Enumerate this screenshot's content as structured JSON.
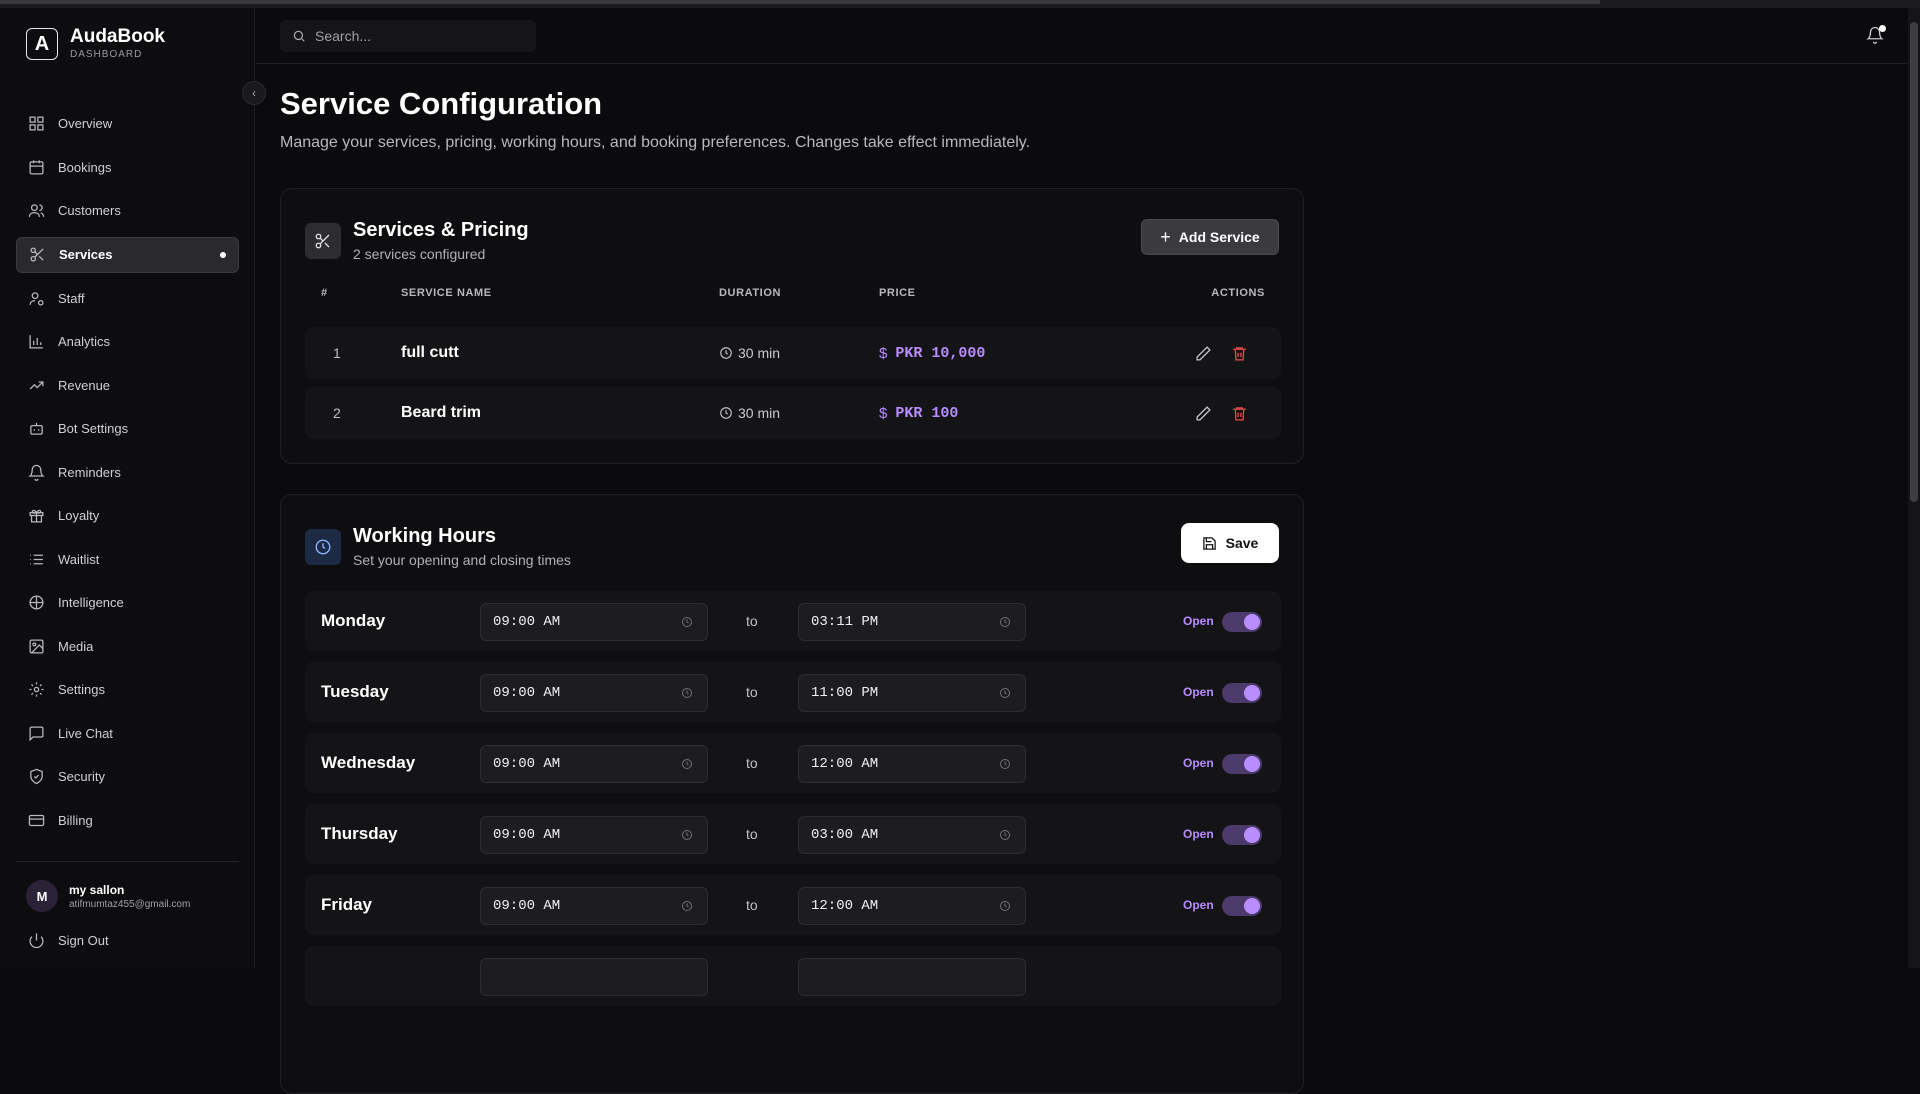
{
  "brand": {
    "name": "AudaBook",
    "subtitle": "DASHBOARD",
    "logo_letter": "A"
  },
  "sidebar": {
    "items": [
      {
        "label": "Overview",
        "icon": "grid-icon"
      },
      {
        "label": "Bookings",
        "icon": "calendar-icon"
      },
      {
        "label": "Customers",
        "icon": "users-icon"
      },
      {
        "label": "Services",
        "icon": "scissors-icon",
        "active": true
      },
      {
        "label": "Staff",
        "icon": "user-cog-icon"
      },
      {
        "label": "Analytics",
        "icon": "bar-chart-icon"
      },
      {
        "label": "Revenue",
        "icon": "trending-up-icon"
      },
      {
        "label": "Bot Settings",
        "icon": "bot-icon"
      },
      {
        "label": "Reminders",
        "icon": "bell-ring-icon"
      },
      {
        "label": "Loyalty",
        "icon": "gift-icon"
      },
      {
        "label": "Waitlist",
        "icon": "list-icon"
      },
      {
        "label": "Intelligence",
        "icon": "brain-icon"
      },
      {
        "label": "Media",
        "icon": "image-icon"
      },
      {
        "label": "Settings",
        "icon": "gear-icon"
      },
      {
        "label": "Live Chat",
        "icon": "chat-icon"
      },
      {
        "label": "Security",
        "icon": "shield-icon"
      },
      {
        "label": "Billing",
        "icon": "credit-card-icon"
      }
    ]
  },
  "user": {
    "initial": "M",
    "name": "my sallon",
    "email": "atifmumtaz455@gmail.com"
  },
  "signout_label": "Sign Out",
  "search": {
    "placeholder": "Search..."
  },
  "page": {
    "title": "Service Configuration",
    "subtitle": "Manage your services, pricing, working hours, and booking preferences. Changes take effect immediately."
  },
  "services_card": {
    "title": "Services & Pricing",
    "subtitle": "2 services configured",
    "add_label": "Add Service",
    "columns": [
      "#",
      "SERVICE NAME",
      "DURATION",
      "PRICE",
      "ACTIONS"
    ],
    "rows": [
      {
        "num": "1",
        "name": "full cutt",
        "duration": "30 min",
        "currency_symbol": "$",
        "price": "PKR 10,000"
      },
      {
        "num": "2",
        "name": "Beard trim",
        "duration": "30 min",
        "currency_symbol": "$",
        "price": "PKR 100"
      }
    ]
  },
  "hours_card": {
    "title": "Working Hours",
    "subtitle": "Set your opening and closing times",
    "save_label": "Save",
    "to_label": "to",
    "open_label": "Open",
    "days": [
      {
        "day": "Monday",
        "open": "09:00 AM",
        "close": "03:11 PM",
        "enabled": true
      },
      {
        "day": "Tuesday",
        "open": "09:00 AM",
        "close": "11:00 PM",
        "enabled": true
      },
      {
        "day": "Wednesday",
        "open": "09:00 AM",
        "close": "12:00 AM",
        "enabled": true
      },
      {
        "day": "Thursday",
        "open": "09:00 AM",
        "close": "03:00 AM",
        "enabled": true
      },
      {
        "day": "Friday",
        "open": "09:00 AM",
        "close": "12:00 AM",
        "enabled": true
      }
    ]
  },
  "colors": {
    "accent": "#b98cff",
    "danger": "#ef4a4a",
    "background": "#0b0b0d"
  }
}
